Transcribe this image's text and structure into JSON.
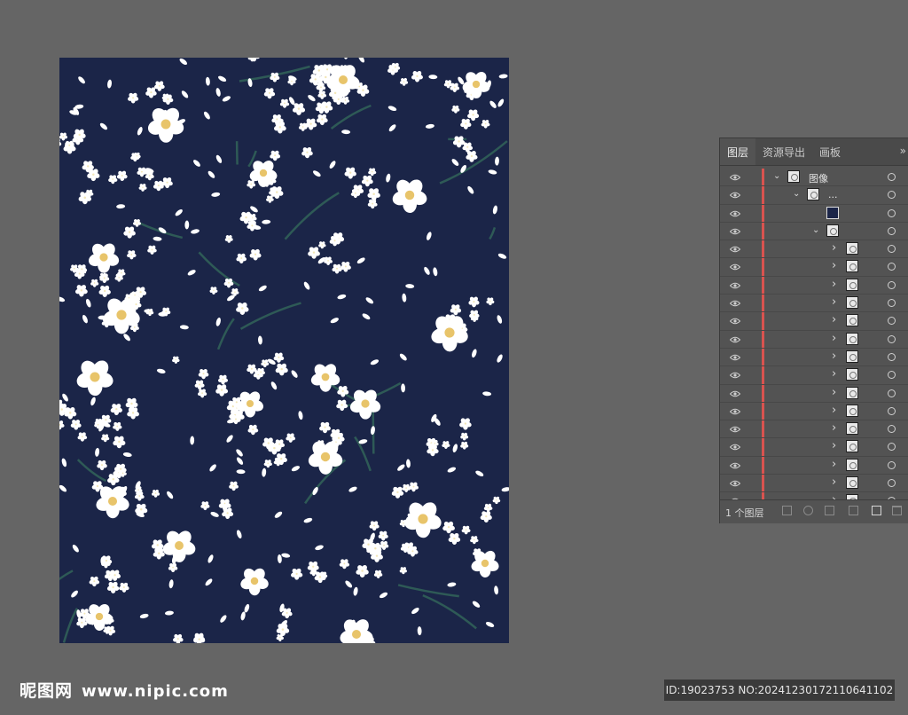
{
  "artboard": {
    "background": "#1b2548",
    "flower_color": "#ffffff",
    "center_color": "#e8c46a",
    "branch_color": "#2e5a56"
  },
  "layers_panel": {
    "tabs": [
      {
        "label": "图层",
        "active": true
      },
      {
        "label": "资源导出",
        "active": false
      },
      {
        "label": "画板",
        "active": false
      }
    ],
    "overflow_icon": "double-chevron-right-icon",
    "rows": [
      {
        "label": "图像",
        "level": 0,
        "expanded": true,
        "thumb": "pattern"
      },
      {
        "label": "...",
        "level": 1,
        "expanded": true,
        "thumb": "pattern"
      },
      {
        "label": "",
        "level": 2,
        "expanded": null,
        "thumb": "dark"
      },
      {
        "label": "",
        "level": 2,
        "expanded": true,
        "thumb": "pattern"
      },
      {
        "label": "",
        "level": 3,
        "expanded": false,
        "thumb": "sprig"
      },
      {
        "label": "",
        "level": 3,
        "expanded": false,
        "thumb": "sprig"
      },
      {
        "label": "",
        "level": 3,
        "expanded": false,
        "thumb": "sprig"
      },
      {
        "label": "",
        "level": 3,
        "expanded": false,
        "thumb": "sprig"
      },
      {
        "label": "",
        "level": 3,
        "expanded": false,
        "thumb": "sprig"
      },
      {
        "label": "",
        "level": 3,
        "expanded": false,
        "thumb": "sprig"
      },
      {
        "label": "",
        "level": 3,
        "expanded": false,
        "thumb": "sprig"
      },
      {
        "label": "",
        "level": 3,
        "expanded": false,
        "thumb": "sprig"
      },
      {
        "label": "",
        "level": 3,
        "expanded": false,
        "thumb": "sprig"
      },
      {
        "label": "",
        "level": 3,
        "expanded": false,
        "thumb": "sprig"
      },
      {
        "label": "",
        "level": 3,
        "expanded": false,
        "thumb": "sprig"
      },
      {
        "label": "",
        "level": 3,
        "expanded": false,
        "thumb": "sprig"
      },
      {
        "label": "",
        "level": 3,
        "expanded": false,
        "thumb": "sprig"
      },
      {
        "label": "",
        "level": 3,
        "expanded": false,
        "thumb": "sprig"
      },
      {
        "label": "",
        "level": 3,
        "expanded": false,
        "thumb": "sprig"
      }
    ],
    "footer": {
      "layer_count": "1 个图层",
      "icons": [
        "export-icon",
        "locate-icon",
        "clipping-mask-icon",
        "new-sublayer-icon",
        "new-layer-icon",
        "delete-icon"
      ]
    }
  },
  "watermark": {
    "site_name": "昵图网",
    "site_url": "www.nipic.com",
    "id_text": "ID:19023753 NO:20241230172110641102"
  }
}
